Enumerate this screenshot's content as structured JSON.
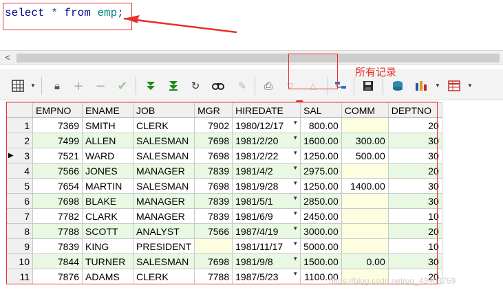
{
  "editor": {
    "kw_select": "select",
    "star": " * ",
    "kw_from": "from",
    "space": " ",
    "table_name": "emp",
    "semicolon": ";"
  },
  "annotation": {
    "label": "所有记录",
    "color": "#e8302a"
  },
  "scrollbar": {
    "left_arrow": "<"
  },
  "toolbar": {
    "icons": [
      "grid-menu-icon",
      "lock-icon",
      "add-row-icon",
      "delete-row-icon",
      "post-icon",
      "fetch-next-icon",
      "fetch-last-icon",
      "refresh-icon",
      "find-icon",
      "clear-icon",
      "print-icon",
      "import-icon",
      "export-icon",
      "query-icon",
      "save-icon",
      "sql-icon",
      "chart-icon",
      "table-view-icon"
    ]
  },
  "grid": {
    "columns": [
      "EMPNO",
      "ENAME",
      "JOB",
      "MGR",
      "HIREDATE",
      "SAL",
      "COMM",
      "DEPTNO"
    ],
    "rows": [
      {
        "n": "1",
        "empno": "7369",
        "ename": "SMITH",
        "job": "CLERK",
        "mgr": "7902",
        "hiredate": "1980/12/17",
        "sal": "800.00",
        "comm": "",
        "deptno": "20"
      },
      {
        "n": "2",
        "empno": "7499",
        "ename": "ALLEN",
        "job": "SALESMAN",
        "mgr": "7698",
        "hiredate": "1981/2/20",
        "sal": "1600.00",
        "comm": "300.00",
        "deptno": "30"
      },
      {
        "n": "3",
        "empno": "7521",
        "ename": "WARD",
        "job": "SALESMAN",
        "mgr": "7698",
        "hiredate": "1981/2/22",
        "sal": "1250.00",
        "comm": "500.00",
        "deptno": "30"
      },
      {
        "n": "4",
        "empno": "7566",
        "ename": "JONES",
        "job": "MANAGER",
        "mgr": "7839",
        "hiredate": "1981/4/2",
        "sal": "2975.00",
        "comm": "",
        "deptno": "20"
      },
      {
        "n": "5",
        "empno": "7654",
        "ename": "MARTIN",
        "job": "SALESMAN",
        "mgr": "7698",
        "hiredate": "1981/9/28",
        "sal": "1250.00",
        "comm": "1400.00",
        "deptno": "30"
      },
      {
        "n": "6",
        "empno": "7698",
        "ename": "BLAKE",
        "job": "MANAGER",
        "mgr": "7839",
        "hiredate": "1981/5/1",
        "sal": "2850.00",
        "comm": "",
        "deptno": "30"
      },
      {
        "n": "7",
        "empno": "7782",
        "ename": "CLARK",
        "job": "MANAGER",
        "mgr": "7839",
        "hiredate": "1981/6/9",
        "sal": "2450.00",
        "comm": "",
        "deptno": "10"
      },
      {
        "n": "8",
        "empno": "7788",
        "ename": "SCOTT",
        "job": "ANALYST",
        "mgr": "7566",
        "hiredate": "1987/4/19",
        "sal": "3000.00",
        "comm": "",
        "deptno": "20"
      },
      {
        "n": "9",
        "empno": "7839",
        "ename": "KING",
        "job": "PRESIDENT",
        "mgr": "",
        "hiredate": "1981/11/17",
        "sal": "5000.00",
        "comm": "",
        "deptno": "10"
      },
      {
        "n": "10",
        "empno": "7844",
        "ename": "TURNER",
        "job": "SALESMAN",
        "mgr": "7698",
        "hiredate": "1981/9/8",
        "sal": "1500.00",
        "comm": "0.00",
        "deptno": "30"
      },
      {
        "n": "11",
        "empno": "7876",
        "ename": "ADAMS",
        "job": "CLERK",
        "mgr": "7788",
        "hiredate": "1987/5/23",
        "sal": "1100.00",
        "comm": "",
        "deptno": "20"
      }
    ],
    "current_row": 3
  },
  "watermark": "https://blog.csdn.net/qq_43403759"
}
